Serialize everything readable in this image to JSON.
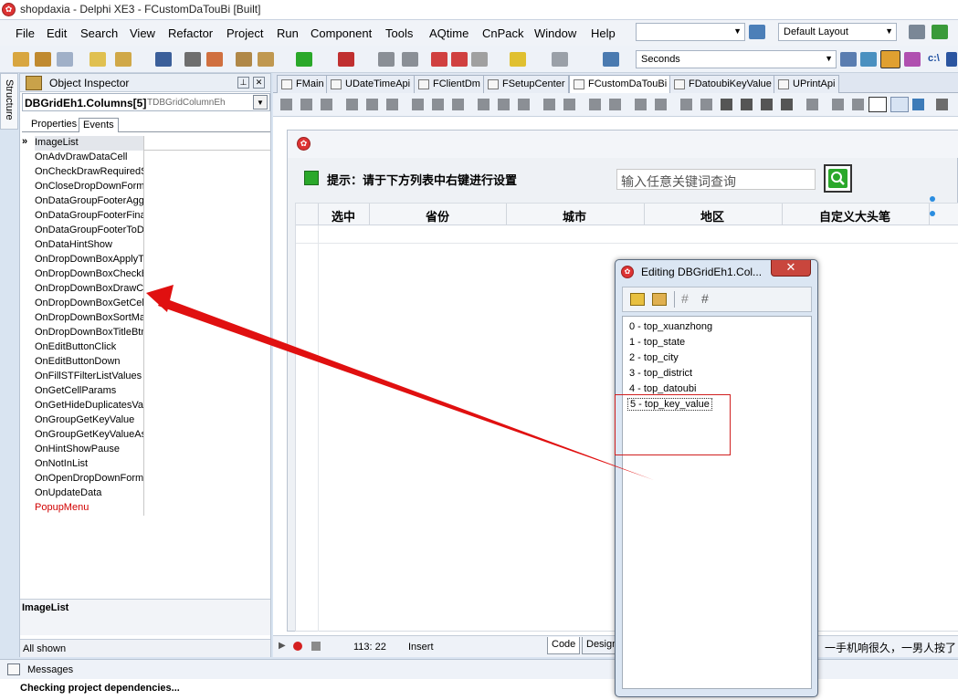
{
  "window": {
    "title": "shopdaxia - Delphi XE3 - FCustomDaTouBi [Built]"
  },
  "menu": [
    "File",
    "Edit",
    "Search",
    "View",
    "Refactor",
    "Project",
    "Run",
    "Component",
    "Tools",
    "AQtime",
    "CnPack",
    "Window",
    "Help"
  ],
  "toolbar": {
    "layout_combo": "Default Layout",
    "seconds_combo": "Seconds",
    "drive_label": "c:\\"
  },
  "structure_tab": "Structure",
  "object_inspector": {
    "title": "Object Inspector",
    "selected_object": "DBGridEh1.Columns[5]",
    "selected_class": "TDBGridColumnEh",
    "tabs": [
      "Properties",
      "Events"
    ],
    "active_tab": "Events",
    "events": [
      "ImageList",
      "OnAdvDrawDataCell",
      "OnCheckDrawRequiredS",
      "OnCloseDropDownForm",
      "OnDataGroupFooterAgg",
      "OnDataGroupFooterFina",
      "OnDataGroupFooterToD",
      "OnDataHintShow",
      "OnDropDownBoxApplyTe",
      "OnDropDownBoxCheckB",
      "OnDropDownBoxDrawCo",
      "OnDropDownBoxGetCellI",
      "OnDropDownBoxSortMar",
      "OnDropDownBoxTitleBtn",
      "OnEditButtonClick",
      "OnEditButtonDown",
      "OnFillSTFilterListValues",
      "OnGetCellParams",
      "OnGetHideDuplicatesValu",
      "OnGroupGetKeyValue",
      "OnGroupGetKeyValueAs",
      "OnHintShowPause",
      "OnNotInList",
      "OnOpenDropDownForm",
      "OnUpdateData",
      "PopupMenu"
    ],
    "description_title": "ImageList",
    "status": "All shown"
  },
  "doc_tabs": [
    "FMain",
    "UDateTimeApi",
    "FClientDm",
    "FSetupCenter",
    "FCustomDaTouBi",
    "FDatoubiKeyValue",
    "UPrintApi"
  ],
  "active_doc_tab": "FCustomDaTouBi",
  "form": {
    "hint": "提示：请于下方列表中右键进行设置",
    "search_placeholder": "输入任意关键词查询",
    "grid_columns": [
      "选中",
      "省份",
      "城市",
      "地区",
      "自定义大头笔"
    ]
  },
  "editor_status": {
    "position": "113:  22",
    "mode": "Insert",
    "tabs": [
      "Code",
      "Design"
    ],
    "overlay_text": "一手机响很久，一男人按了"
  },
  "messages": {
    "title": "Messages",
    "text": "Checking project dependencies..."
  },
  "dialog": {
    "title": "Editing DBGridEh1.Col...",
    "items": [
      "0 - top_xuanzhong",
      "1 - top_state",
      "2 - top_city",
      "3 - top_district",
      "4 - top_datoubi",
      "5 - top_key_value"
    ],
    "selected_index": 5
  },
  "colors": {
    "annotation_red": "#e01010",
    "menu_bg": "#f0f3f8",
    "accent_green": "#2aa82a"
  }
}
